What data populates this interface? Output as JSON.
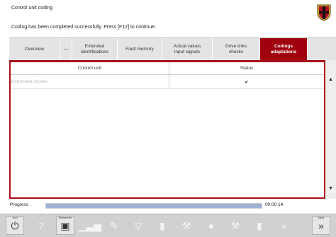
{
  "header": {
    "title": "Control unit coding",
    "message": "Coding has been completed successfully. Press [F12] to continue."
  },
  "tabs": [
    {
      "label": "Overview",
      "active": false
    },
    {
      "label": "—",
      "active": false
    },
    {
      "label": "Extended\nidentifications",
      "active": false
    },
    {
      "label": "Fault memory",
      "active": false
    },
    {
      "label": "Actual values\ninput signals",
      "active": false
    },
    {
      "label": "Drive links\nchecks",
      "active": false
    },
    {
      "label": "Codings\nadaptations",
      "active": true
    },
    {
      "label": "",
      "active": false
    }
  ],
  "table": {
    "headers": {
      "control_unit": "Control unit",
      "status": "Status"
    },
    "rows": [
      {
        "control_unit": "Instrument cluster",
        "status": "✔"
      }
    ]
  },
  "progress": {
    "label": "Progress",
    "value": 1.0,
    "time": "00:00:14"
  },
  "toolbar": {
    "exit_label": "End",
    "multimeter_label": "Multimeter",
    "next_label": "Next",
    "buttons": [
      {
        "name": "exit-button",
        "glyph": "⏻",
        "enabled": true
      },
      {
        "name": "help-button",
        "glyph": "?",
        "enabled": false
      },
      {
        "name": "multimeter-button",
        "glyph": "▣",
        "enabled": true
      },
      {
        "name": "chart-button",
        "glyph": "▁▃▅",
        "enabled": false
      },
      {
        "name": "edit-button",
        "glyph": "✎",
        "enabled": false
      },
      {
        "name": "filter-button",
        "glyph": "▽",
        "enabled": false
      },
      {
        "name": "battery-button",
        "glyph": "▮",
        "enabled": false
      },
      {
        "name": "wrench-button",
        "glyph": "⚒",
        "enabled": false
      },
      {
        "name": "stop-button",
        "glyph": "●",
        "enabled": false
      },
      {
        "name": "tools-button",
        "glyph": "⚒",
        "enabled": false
      },
      {
        "name": "save-button",
        "glyph": "▮",
        "enabled": false
      },
      {
        "name": "back-button",
        "glyph": "«",
        "enabled": false
      },
      {
        "name": "next-button",
        "glyph": "»",
        "enabled": true
      }
    ]
  },
  "colors": {
    "accent": "#a1000e",
    "progress_fill": "#9fb4d2"
  }
}
